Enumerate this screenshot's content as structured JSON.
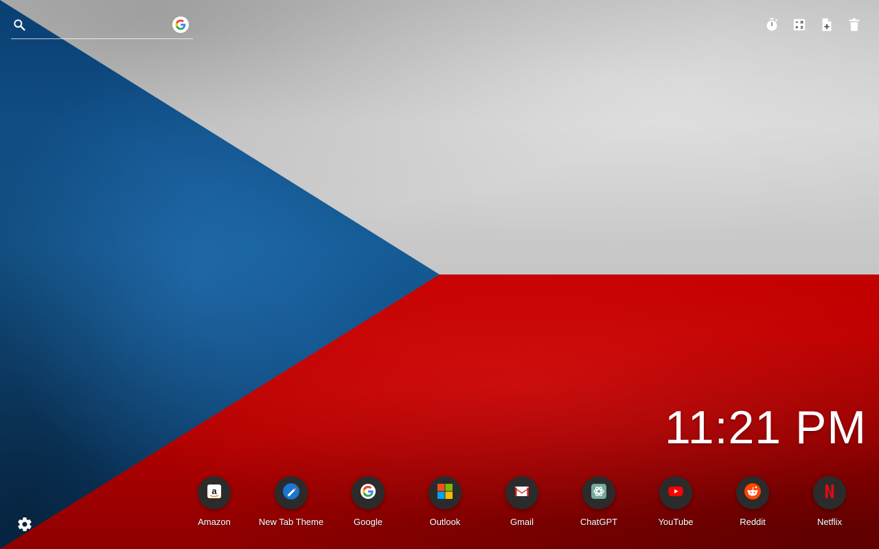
{
  "search": {
    "placeholder": "",
    "value": "",
    "engine_icon": "google-icon"
  },
  "toolbar": {
    "icons": [
      "timer-icon",
      "calculator-icon",
      "add-note-icon",
      "trash-icon"
    ]
  },
  "clock": {
    "time": "11:21 PM"
  },
  "shortcuts": [
    {
      "label": "Amazon",
      "icon": "amazon-icon"
    },
    {
      "label": "New Tab Theme",
      "icon": "new-tab-theme-icon"
    },
    {
      "label": "Google",
      "icon": "google-icon"
    },
    {
      "label": "Outlook",
      "icon": "outlook-icon"
    },
    {
      "label": "Gmail",
      "icon": "gmail-icon"
    },
    {
      "label": "ChatGPT",
      "icon": "chatgpt-icon"
    },
    {
      "label": "YouTube",
      "icon": "youtube-icon"
    },
    {
      "label": "Reddit",
      "icon": "reddit-icon"
    },
    {
      "label": "Netflix",
      "icon": "netflix-icon"
    }
  ],
  "settings": {
    "icon": "gear-icon"
  },
  "colors": {
    "flag_blue": "#11457E",
    "flag_red": "#D7141A",
    "flag_white": "#D0D0D0",
    "shortcut_bg": "#2B2B2B",
    "text": "#FFFFFF"
  }
}
